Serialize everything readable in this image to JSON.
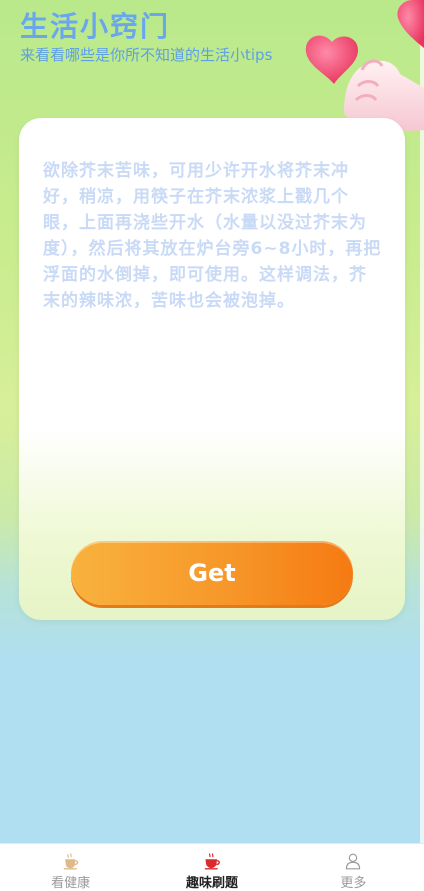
{
  "header": {
    "title": "生活小窍门",
    "subtitle": "来看看哪些是你所不知道的生活小tips"
  },
  "card": {
    "tip": "欲除芥末苦味，可用少许开水将芥末冲好，稍凉，用筷子在芥末浓浆上戳几个眼，上面再浇些开水（水量以没过芥末为度），然后将其放在炉台旁6~8小时，再把浮面的水倒掉，即可使用。这样调法，芥末的辣味浓，苦味也会被泡掉。",
    "button_label": "Get"
  },
  "tabbar": {
    "items": [
      {
        "label": "看健康",
        "icon": "coffee-cup-icon",
        "active": false
      },
      {
        "label": "趣味刷题",
        "icon": "teacup-icon",
        "active": true
      },
      {
        "label": "更多",
        "icon": "user-icon",
        "active": false
      }
    ]
  },
  "colors": {
    "title": "#6aa6ee",
    "button": "#f7972a",
    "tip_text": "#c9daf6"
  }
}
